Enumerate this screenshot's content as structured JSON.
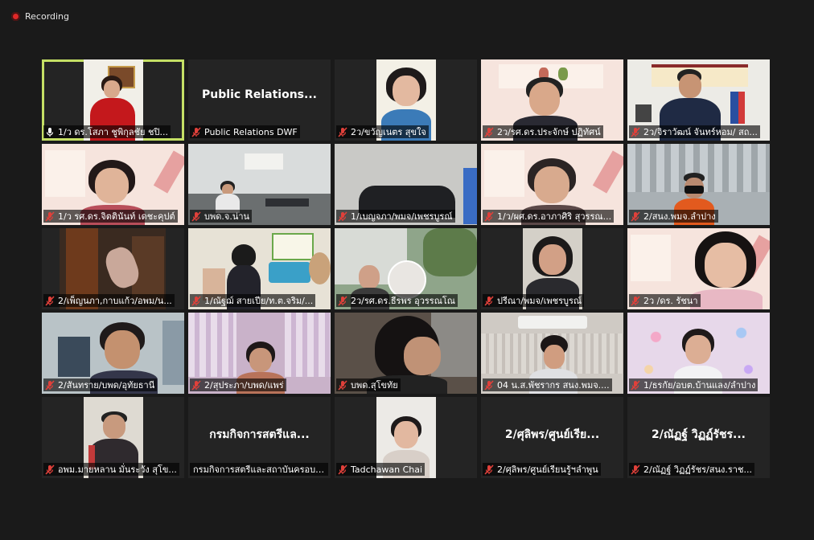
{
  "recording": {
    "label": "Recording"
  },
  "tiles": [
    {
      "name": "1/ว ดร.โสภา ชูพิกุลชัย ชปิ...",
      "big": "",
      "muted": false,
      "speaking": true
    },
    {
      "name": "Public Relations DWF",
      "big": "Public Relations...",
      "muted": true
    },
    {
      "name": "2ว/ขวัญเนตร สุขใจ",
      "big": "",
      "muted": true
    },
    {
      "name": "2ว/รศ.ดร.ประจักษ์ ปฏิทัศน์",
      "big": "",
      "muted": true
    },
    {
      "name": "2ว/จิราวัฒน์ จันทร์หอม/ สถ...",
      "big": "",
      "muted": true
    },
    {
      "name": "1/ว รศ.ดร.จิตตินันท์ เดชะคุปต์",
      "big": "",
      "muted": true
    },
    {
      "name": "บพด.จ.น่าน",
      "big": "",
      "muted": true
    },
    {
      "name": "1/เบญจภา/พมจ/เพชรบูรณ์",
      "big": "",
      "muted": true
    },
    {
      "name": "1/ว/ผศ.ดร.อาภาศิริ สุวรรณ...",
      "big": "",
      "muted": true
    },
    {
      "name": "2/สนง.พมจ.ลำปาง",
      "big": "",
      "muted": true
    },
    {
      "name": "2/เพ็ญนภา,กาบแก้ว/อพม/น...",
      "big": "",
      "muted": true
    },
    {
      "name": "1/ณัฐฌ์ สายเปีย/ท.ต.จริม/...",
      "big": "",
      "muted": true
    },
    {
      "name": "2ว/รศ.ดร.ธีรพร อุวรรณโณ",
      "big": "",
      "muted": true
    },
    {
      "name": "ปรีณา/พมจ/เพชรบูรณ์",
      "big": "",
      "muted": true
    },
    {
      "name": "2ว /ดร. รัชนา",
      "big": "",
      "muted": true
    },
    {
      "name": "2/สันทราย/บพด/อุทัยธานี",
      "big": "",
      "muted": true
    },
    {
      "name": "2/สุประภา/บพด/แพร่",
      "big": "",
      "muted": true
    },
    {
      "name": "บพด.สุโขทัย",
      "big": "",
      "muted": true
    },
    {
      "name": "04 น.ส.พัชรากร สนง.พมจ....",
      "big": "",
      "muted": true
    },
    {
      "name": "1/ธรกัย/อบต.บ้านแลง/ลำปาง",
      "big": "",
      "muted": true
    },
    {
      "name": "อพม.มายหลาน มั่นระวัง สุโข...",
      "big": "",
      "muted": true
    },
    {
      "name": "กรมกิจการสตรีและสถาบันครอบค...",
      "big": "กรมกิจการสตรีแล...",
      "muted": false
    },
    {
      "name": "Tadchawan Chai",
      "big": "",
      "muted": true
    },
    {
      "name": "2/ศุลิพร/ศูนย์เรียนรู้ฯลำพูน",
      "big": "2/ศุลิพร/ศูนย์เรีย...",
      "muted": true
    },
    {
      "name": "2/ณัฏฐ์ วิฏฏ์รัชร/สนง.ราช...",
      "big": "2/ณัฏฐ์ วิฏฏ์รัชร...",
      "muted": true
    }
  ],
  "colors": {
    "speaking_border": "#c5e065",
    "recording_dot": "#e02828",
    "muted_mic": "#e0403a"
  }
}
